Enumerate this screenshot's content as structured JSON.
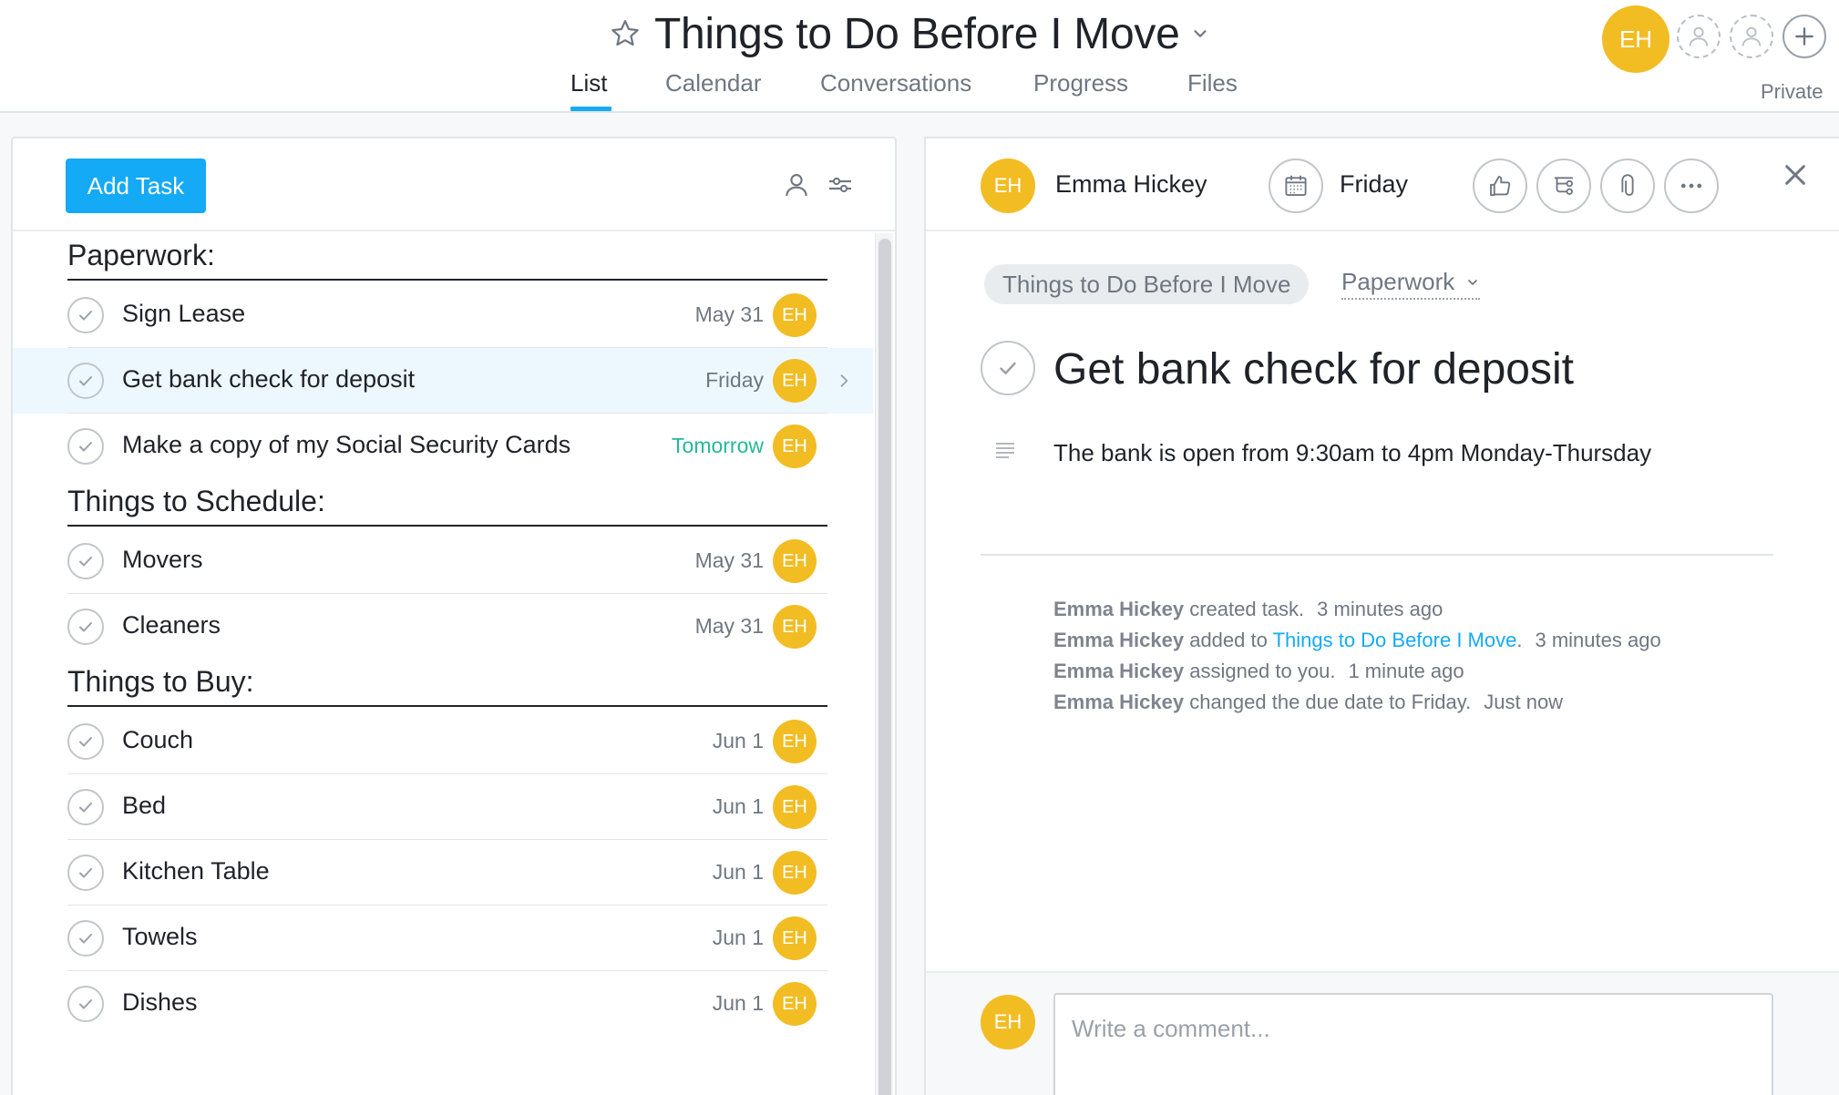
{
  "project": {
    "title": "Things to Do Before I Move",
    "privacy": "Private",
    "owner_initials": "EH"
  },
  "tabs": [
    {
      "label": "List",
      "active": true
    },
    {
      "label": "Calendar",
      "active": false
    },
    {
      "label": "Conversations",
      "active": false
    },
    {
      "label": "Progress",
      "active": false
    },
    {
      "label": "Files",
      "active": false
    }
  ],
  "list_toolbar": {
    "add_task_label": "Add Task"
  },
  "sections": [
    {
      "title": "Paperwork:",
      "tasks": [
        {
          "name": "Sign Lease",
          "due": "May 31",
          "assignee": "EH"
        },
        {
          "name": "Get bank check for deposit",
          "due": "Friday",
          "assignee": "EH",
          "selected": true
        },
        {
          "name": "Make a copy of my Social Security Cards",
          "due": "Tomorrow",
          "assignee": "EH",
          "due_soon": true
        }
      ]
    },
    {
      "title": "Things to Schedule:",
      "tasks": [
        {
          "name": "Movers",
          "due": "May 31",
          "assignee": "EH"
        },
        {
          "name": "Cleaners",
          "due": "May 31",
          "assignee": "EH"
        }
      ]
    },
    {
      "title": "Things to Buy:",
      "tasks": [
        {
          "name": "Couch",
          "due": "Jun 1",
          "assignee": "EH"
        },
        {
          "name": "Bed",
          "due": "Jun 1",
          "assignee": "EH"
        },
        {
          "name": "Kitchen Table",
          "due": "Jun 1",
          "assignee": "EH"
        },
        {
          "name": "Towels",
          "due": "Jun 1",
          "assignee": "EH"
        },
        {
          "name": "Dishes",
          "due": "Jun 1",
          "assignee": "EH"
        }
      ]
    }
  ],
  "detail": {
    "assignee_initials": "EH",
    "assignee_name": "Emma Hickey",
    "due": "Friday",
    "project_pill": "Things to Do Before I Move",
    "section": "Paperwork",
    "task_title": "Get bank check for deposit",
    "description": "The bank is open from 9:30am to 4pm Monday-Thursday",
    "activity": [
      {
        "who": "Emma Hickey",
        "text": " created task.",
        "link": "",
        "after": "",
        "when": "3 minutes ago"
      },
      {
        "who": "Emma Hickey",
        "text": " added to ",
        "link": "Things to Do Before I Move",
        "after": ".",
        "when": "3 minutes ago"
      },
      {
        "who": "Emma Hickey",
        "text": " assigned to you.",
        "link": "",
        "after": "",
        "when": "1 minute ago"
      },
      {
        "who": "Emma Hickey",
        "text": " changed the due date to Friday.",
        "link": "",
        "after": "",
        "when": "Just now"
      }
    ],
    "comment_avatar": "EH",
    "comment_placeholder": "Write a comment..."
  },
  "colors": {
    "accent": "#14aaf5",
    "avatar": "#f2bc23",
    "due_soon": "#25b89a",
    "selected_row": "#edf8fe"
  }
}
